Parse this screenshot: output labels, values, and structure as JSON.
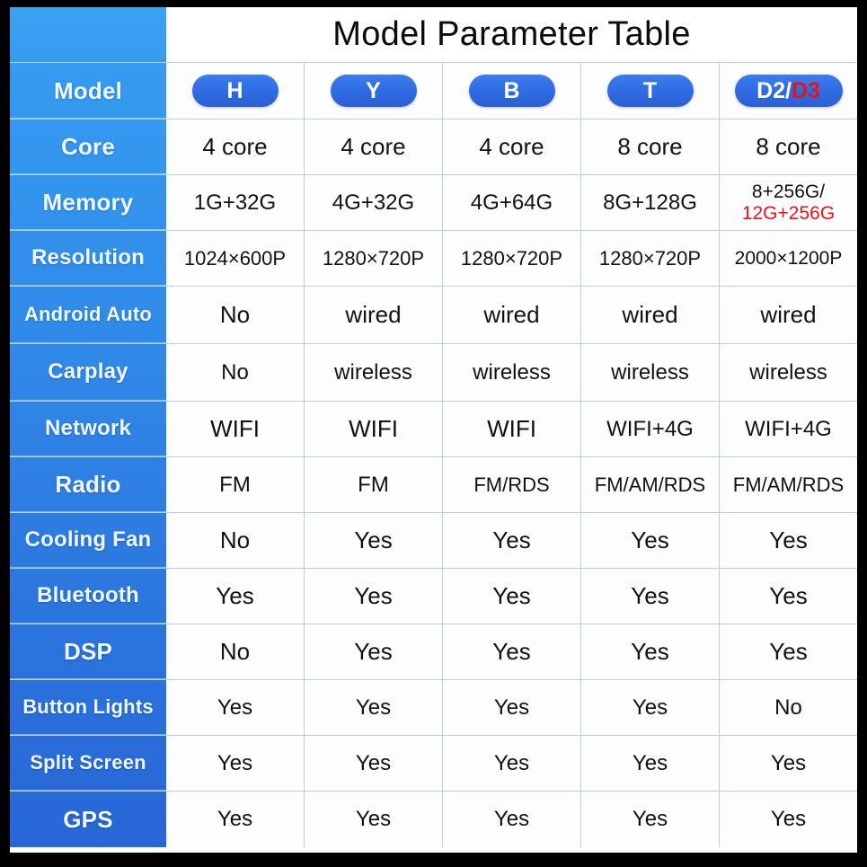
{
  "title": "Model Parameter Table",
  "colors": {
    "sidebar_blue_top": "#38a0f0",
    "sidebar_blue_bottom": "#3366dd",
    "accent_red": "#e81414",
    "pill_blue": "#2f6ae0",
    "grid_line": "#b9cfe8"
  },
  "row_label_header": "Model",
  "models": [
    {
      "label": "H",
      "label_red": ""
    },
    {
      "label": "Y",
      "label_red": ""
    },
    {
      "label": "B",
      "label_red": ""
    },
    {
      "label": "T",
      "label_red": ""
    },
    {
      "label": "D2/",
      "label_red": "D3"
    }
  ],
  "rows": [
    {
      "label": "Core",
      "values": [
        "4 core",
        "4 core",
        "4 core",
        "8 core",
        "8 core"
      ]
    },
    {
      "label": "Memory",
      "values": [
        "1G+32G",
        "4G+32G",
        "4G+64G",
        "8G+128G",
        ""
      ],
      "special": {
        "index": 4,
        "line1": "8+256G/",
        "line2": "12G+256G"
      }
    },
    {
      "label": "Resolution",
      "values": [
        "1024×600P",
        "1280×720P",
        "1280×720P",
        "1280×720P",
        "2000×1200P"
      ]
    },
    {
      "label": "Android Auto",
      "values": [
        "No",
        "wired",
        "wired",
        "wired",
        "wired"
      ]
    },
    {
      "label": "Carplay",
      "values": [
        "No",
        "wireless",
        "wireless",
        "wireless",
        "wireless"
      ]
    },
    {
      "label": "Network",
      "values": [
        "WIFI",
        "WIFI",
        "WIFI",
        "WIFI+4G",
        "WIFI+4G"
      ]
    },
    {
      "label": "Radio",
      "values": [
        "FM",
        "FM",
        "FM/RDS",
        "FM/AM/RDS",
        "FM/AM/RDS"
      ]
    },
    {
      "label": "Cooling Fan",
      "values": [
        "No",
        "Yes",
        "Yes",
        "Yes",
        "Yes"
      ]
    },
    {
      "label": "Bluetooth",
      "values": [
        "Yes",
        "Yes",
        "Yes",
        "Yes",
        "Yes"
      ]
    },
    {
      "label": "DSP",
      "values": [
        "No",
        "Yes",
        "Yes",
        "Yes",
        "Yes"
      ]
    },
    {
      "label": "Button Lights",
      "values": [
        "Yes",
        "Yes",
        "Yes",
        "Yes",
        "No"
      ]
    },
    {
      "label": "Split Screen",
      "values": [
        "Yes",
        "Yes",
        "Yes",
        "Yes",
        "Yes"
      ]
    },
    {
      "label": "GPS",
      "values": [
        "Yes",
        "Yes",
        "Yes",
        "Yes",
        "Yes"
      ]
    }
  ]
}
